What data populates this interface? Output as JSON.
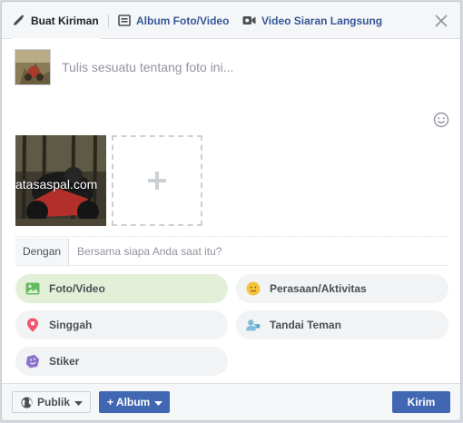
{
  "tabs": [
    {
      "label": "Buat Kiriman",
      "icon": "pencil-icon"
    },
    {
      "label": "Album Foto/Video",
      "icon": "album-icon"
    },
    {
      "label": "Video Siaran Langsung",
      "icon": "video-camera-icon"
    }
  ],
  "composer": {
    "placeholder": "Tulis sesuatu tentang foto ini...",
    "photo_watermark": "atasaspal.com"
  },
  "with": {
    "label": "Dengan",
    "placeholder": "Bersama siapa Anda saat itu?"
  },
  "actions": [
    {
      "label": "Foto/Video",
      "icon": "photo-icon",
      "active": true
    },
    {
      "label": "Perasaan/Aktivitas",
      "icon": "smiley-icon",
      "active": false
    },
    {
      "label": "Singgah",
      "icon": "location-pin-icon",
      "active": false
    },
    {
      "label": "Tandai Teman",
      "icon": "tag-friend-icon",
      "active": false
    },
    {
      "label": "Stiker",
      "icon": "sticker-icon",
      "active": false
    }
  ],
  "footer": {
    "privacy_label": "Publik",
    "album_label": "+ Album",
    "send_label": "Kirim"
  },
  "colors": {
    "accent": "#4267b2",
    "link": "#365899",
    "active_pill": "#e3f0d7"
  }
}
